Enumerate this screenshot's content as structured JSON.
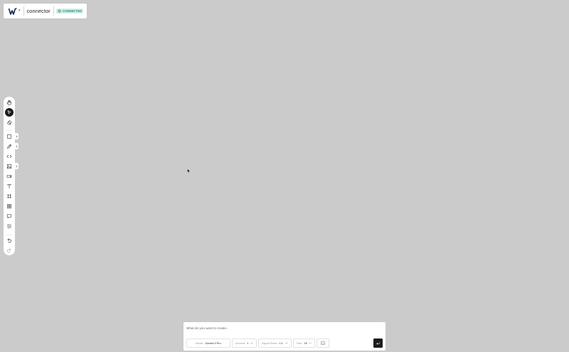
{
  "header": {
    "app_name": "connector",
    "status_badge": "CONNECTED"
  },
  "toolbar": {
    "tools": [
      {
        "name": "hand-icon"
      },
      {
        "name": "select-pointer-icon",
        "active": true
      },
      {
        "name": "eraser-icon"
      },
      {
        "name": "rectangle-icon"
      },
      {
        "name": "pencil-icon"
      },
      {
        "name": "code-icon"
      },
      {
        "name": "image-icon"
      },
      {
        "name": "video-icon"
      },
      {
        "name": "text-icon"
      },
      {
        "name": "frame-icon"
      },
      {
        "name": "grid-layout-icon"
      },
      {
        "name": "comment-icon"
      },
      {
        "name": "layers-icon"
      },
      {
        "name": "undo-icon"
      },
      {
        "name": "redo-icon"
      }
    ]
  },
  "prompt": {
    "placeholder": "What do you want to create...",
    "model_label": "Model:",
    "model_value": "Gemini 3 Pro",
    "amount_label": "Amount:",
    "amount_value": "1",
    "aspect_label": "Aspect Ratio:",
    "aspect_value": "1:1",
    "size_label": "Size:",
    "size_value": "1K"
  },
  "colors": {
    "canvas_bg": "#cbcbcb",
    "badge_bg": "#d3efe9",
    "badge_text": "#2c8a76",
    "active_tool": "#1c1c1c"
  }
}
